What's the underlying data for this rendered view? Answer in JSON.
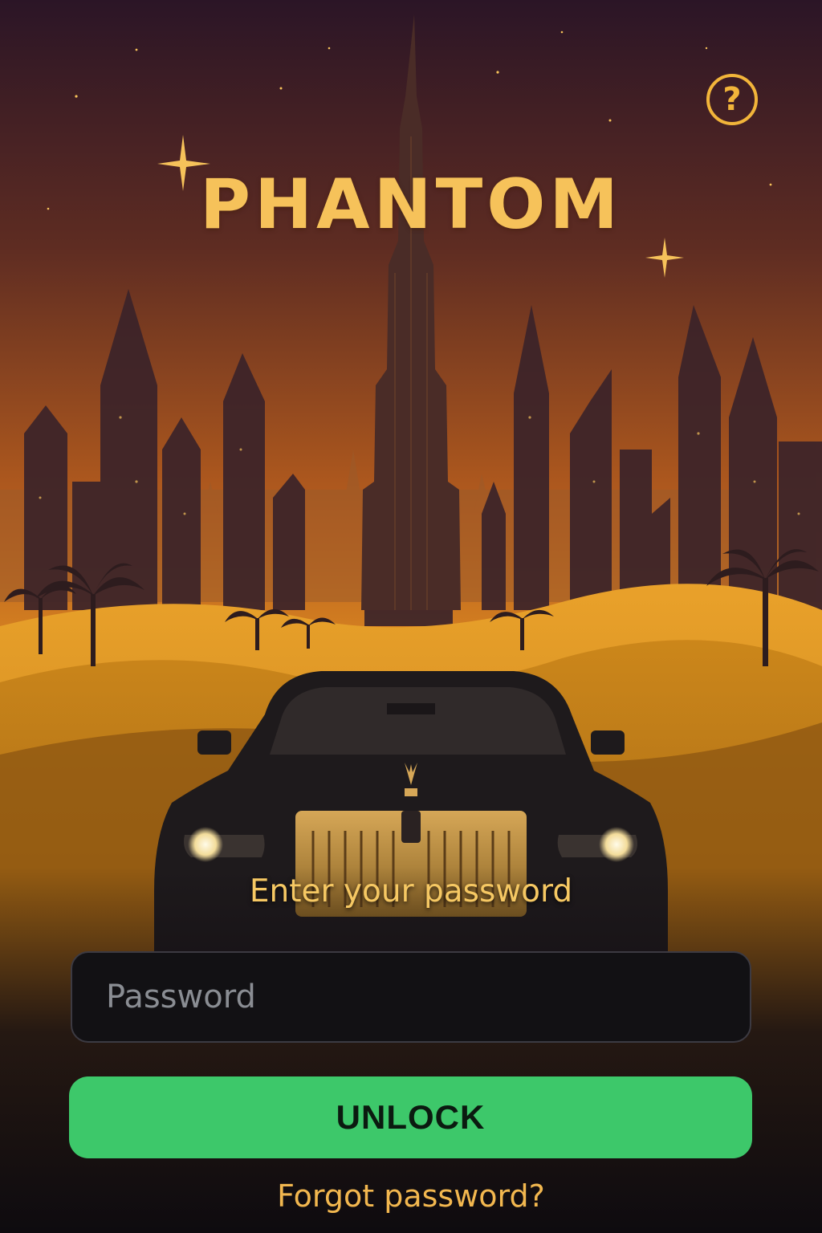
{
  "app": {
    "title": "PHANTOM"
  },
  "header": {
    "help_icon": "question-mark-circle-icon",
    "help_glyph": "?"
  },
  "hero": {
    "scene": "city-skyline-desert-car-illustration",
    "emblem_icon": "car-hood-ornament-icon"
  },
  "login": {
    "prompt": "Enter your password",
    "password_placeholder": "Password",
    "password_value": "",
    "unlock_label": "UNLOCK",
    "forgot_label": "Forgot password?"
  },
  "colors": {
    "accent_gold": "#f6c25a",
    "unlock_green": "#3dc86a",
    "field_background": "#121114",
    "page_background": "#120d12"
  }
}
